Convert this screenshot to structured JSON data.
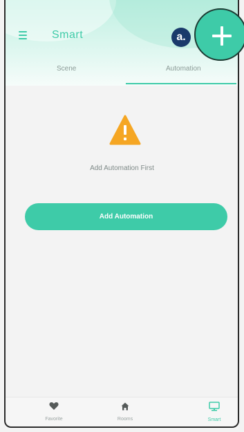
{
  "header": {
    "title": "Smart",
    "menu_icon": "menu-icon",
    "tabs": [
      {
        "label": "Scene",
        "active": false
      },
      {
        "label": "Automation",
        "active": true
      }
    ]
  },
  "annotation": {
    "label": "a."
  },
  "add_icon": "plus-icon",
  "main": {
    "warning_icon": "warning-icon",
    "empty_message": "Add Automation First",
    "add_button_label": "Add Automation"
  },
  "tabbar": {
    "items": [
      {
        "label": "Favorite",
        "icon": "heart-icon",
        "active": false
      },
      {
        "label": "Rooms",
        "icon": "home-icon",
        "active": false
      },
      {
        "label": "Smart",
        "icon": "monitor-icon",
        "active": true
      }
    ]
  },
  "colors": {
    "accent": "#3ecba8",
    "warning": "#f5a623",
    "annotation_badge": "#1a3a6b"
  }
}
